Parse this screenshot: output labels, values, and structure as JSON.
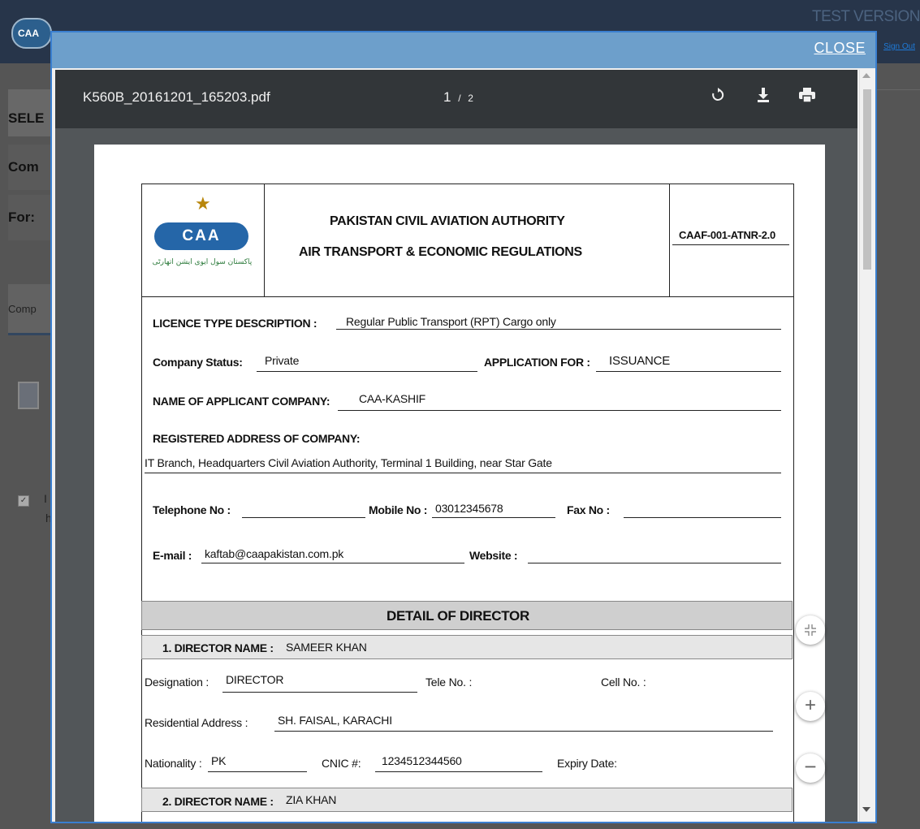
{
  "background": {
    "logo_text": "CAA",
    "test_version": "TEST VERSION",
    "sign_out": "Sign Out",
    "side_labels": [
      "SELE",
      "Com",
      "For:"
    ],
    "side_tab": "Comp",
    "side_check_text": "I",
    "side_check_text2": "h"
  },
  "modal": {
    "close_label": "CLOSE"
  },
  "viewer": {
    "filename": "K560B_20161201_165203.pdf",
    "current_page": "1",
    "page_sep": "/",
    "total_pages": "2",
    "icons": {
      "rotate": "rotate-icon",
      "download": "download-icon",
      "print": "print-icon"
    }
  },
  "document": {
    "header": {
      "org_line1": "PAKISTAN CIVIL AVIATION AUTHORITY",
      "org_line2": "AIR TRANSPORT & ECONOMIC REGULATIONS",
      "form_code": "CAAF-001-ATNR-2.0",
      "logo_text": "CAA",
      "logo_urdu": "پاکستان سول ایوی ایشن اتھارٹی"
    },
    "licence_label": "LICENCE TYPE DESCRIPTION :",
    "licence_value": "Regular Public Transport (RPT) Cargo only",
    "status_label": "Company Status:",
    "status_value": "Private",
    "application_label": "APPLICATION FOR :",
    "application_value": "ISSUANCE",
    "applicant_label": "NAME OF APPLICANT COMPANY:",
    "applicant_value": "CAA-KASHIF",
    "address_label": "REGISTERED ADDRESS OF COMPANY:",
    "address_value": "IT Branch, Headquarters Civil Aviation Authority, Terminal 1 Building, near Star Gate",
    "telephone_label": "Telephone No :",
    "telephone_value": "",
    "mobile_label": "Mobile No :",
    "mobile_value": "03012345678",
    "fax_label": "Fax No :",
    "fax_value": "",
    "email_label": "E-mail :",
    "email_value": "kaftab@caapakistan.com.pk",
    "website_label": "Website :",
    "website_value": "",
    "director_section_title": "DETAIL OF DIRECTOR",
    "director1": {
      "label": "1. DIRECTOR NAME :",
      "name": "SAMEER KHAN",
      "designation_label": "Designation :",
      "designation_value": "DIRECTOR",
      "tele_label": "Tele No. :",
      "cell_label": "Cell No. :",
      "residential_label": "Residential Address :",
      "residential_value": "SH. FAISAL, KARACHI",
      "nationality_label": "Nationality :",
      "nationality_value": "PK",
      "cnic_label": "CNIC #:",
      "cnic_value": "1234512344560",
      "expiry_label": "Expiry Date:"
    },
    "director2": {
      "label": "2. DIRECTOR NAME :",
      "name": "ZIA KHAN"
    }
  },
  "controls": {
    "fit_icon": "fit-page-icon",
    "zoom_in_icon": "zoom-in-icon",
    "zoom_out_icon": "zoom-out-icon"
  }
}
